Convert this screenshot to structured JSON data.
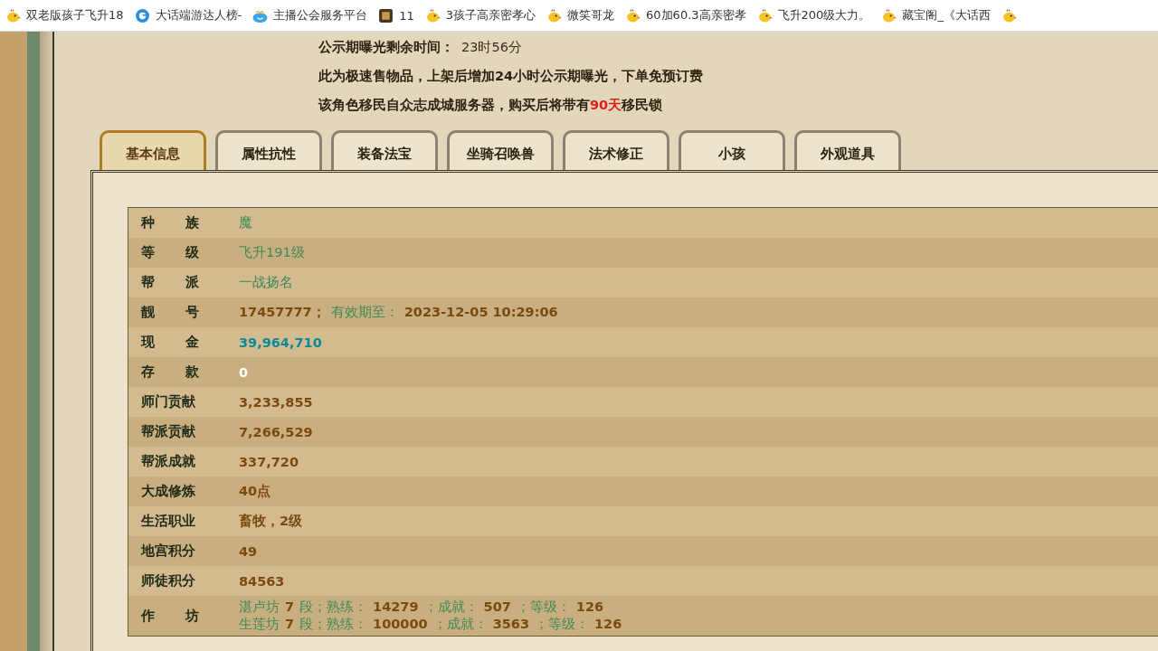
{
  "bookmarks": [
    {
      "label": "双老版孩子飞升18"
    },
    {
      "label": "大话端游达人榜-"
    },
    {
      "label": "主播公会服务平台"
    },
    {
      "label": "11"
    },
    {
      "label": "3孩子高亲密孝心"
    },
    {
      "label": "微笑哥龙"
    },
    {
      "label": "60加60.3高亲密孝"
    },
    {
      "label": "飞升200级大力。"
    },
    {
      "label": "藏宝阁_《大话西"
    }
  ],
  "notice": [
    [
      {
        "kind": "label",
        "text": "公示期曝光剩余时间："
      },
      {
        "kind": "plain",
        "text": "23时56分"
      }
    ],
    [
      {
        "kind": "label",
        "text": "此为极速售物品，上架后增加24小时公示期曝光，下单免预订费"
      }
    ],
    [
      {
        "kind": "label",
        "text": "该角色移民自众志成城服务器，购买后将带有"
      },
      {
        "kind": "alert",
        "text": "90天"
      },
      {
        "kind": "label",
        "text": "移民锁"
      }
    ]
  ],
  "tabs": [
    {
      "label": "基本信息",
      "selected": true
    },
    {
      "label": "属性抗性",
      "selected": false
    },
    {
      "label": "装备法宝",
      "selected": false
    },
    {
      "label": "坐骑召唤兽",
      "selected": false
    },
    {
      "label": "法术修正",
      "selected": false
    },
    {
      "label": "小孩",
      "selected": false
    },
    {
      "label": "外观道具",
      "selected": false
    }
  ],
  "rows": [
    {
      "label": "种族",
      "lines": [
        [
          {
            "kind": "green",
            "text": "魔"
          }
        ]
      ]
    },
    {
      "label": "等级",
      "lines": [
        [
          {
            "kind": "green",
            "text": "飞升191级"
          }
        ]
      ]
    },
    {
      "label": "帮派",
      "lines": [
        [
          {
            "kind": "green",
            "text": "一战扬名"
          }
        ]
      ]
    },
    {
      "label": "靓号",
      "lines": [
        [
          {
            "kind": "number",
            "text": "17457777；"
          },
          {
            "kind": "green",
            "text": "有效期至："
          },
          {
            "kind": "number",
            "text": "2023-12-05 10:29:06"
          }
        ]
      ]
    },
    {
      "label": "现金",
      "lines": [
        [
          {
            "kind": "cash",
            "text": "39,964,710"
          }
        ]
      ]
    },
    {
      "label": "存款",
      "lines": [
        [
          {
            "kind": "zero",
            "text": "0"
          }
        ]
      ]
    },
    {
      "label": "师门贡献",
      "lines": [
        [
          {
            "kind": "number",
            "text": "3,233,855"
          }
        ]
      ]
    },
    {
      "label": "帮派贡献",
      "lines": [
        [
          {
            "kind": "number",
            "text": "7,266,529"
          }
        ]
      ]
    },
    {
      "label": "帮派成就",
      "lines": [
        [
          {
            "kind": "number",
            "text": "337,720"
          }
        ]
      ]
    },
    {
      "label": "大成修炼",
      "lines": [
        [
          {
            "kind": "number",
            "text": "40点"
          }
        ]
      ]
    },
    {
      "label": "生活职业",
      "lines": [
        [
          {
            "kind": "number",
            "text": "畜牧，2级"
          }
        ]
      ]
    },
    {
      "label": "地宫积分",
      "lines": [
        [
          {
            "kind": "number",
            "text": "49"
          }
        ]
      ]
    },
    {
      "label": "师徒积分",
      "lines": [
        [
          {
            "kind": "number",
            "text": "84563"
          }
        ]
      ]
    },
    {
      "label": "作坊",
      "lines": [
        [
          {
            "kind": "green",
            "text": "湛卢坊"
          },
          {
            "kind": "number",
            "text": "7"
          },
          {
            "kind": "green",
            "text": "段；熟练："
          },
          {
            "kind": "number",
            "text": "14279"
          },
          {
            "kind": "green",
            "text": "；成就："
          },
          {
            "kind": "number",
            "text": "507"
          },
          {
            "kind": "green",
            "text": "；等级："
          },
          {
            "kind": "number",
            "text": "126"
          }
        ],
        [
          {
            "kind": "green",
            "text": "生莲坊"
          },
          {
            "kind": "number",
            "text": "7"
          },
          {
            "kind": "green",
            "text": "段；熟练："
          },
          {
            "kind": "number",
            "text": "100000"
          },
          {
            "kind": "green",
            "text": "；成就："
          },
          {
            "kind": "number",
            "text": "3563"
          },
          {
            "kind": "green",
            "text": "；等级："
          },
          {
            "kind": "number",
            "text": "126"
          }
        ]
      ]
    }
  ]
}
